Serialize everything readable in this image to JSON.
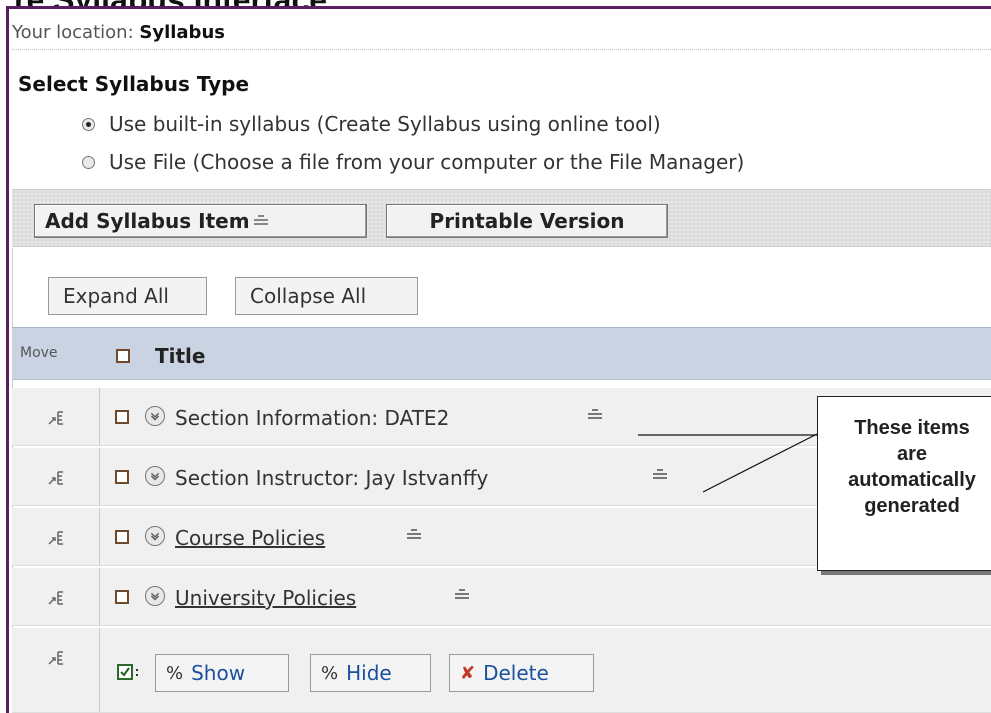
{
  "header": {
    "cut_title": "re Syllabus Interface",
    "location_prefix": "Your location:",
    "location": "Syllabus"
  },
  "syllabus_type": {
    "title": "Select Syllabus Type",
    "options": [
      {
        "label": "Use built-in syllabus  (Create Syllabus using online tool)",
        "selected": true
      },
      {
        "label": "Use File  (Choose a file from your computer or the File Manager)",
        "selected": false
      }
    ]
  },
  "toolbar": {
    "add_item": "Add Syllabus Item",
    "printable": "Printable Version"
  },
  "actions": {
    "expand_all": "Expand All",
    "collapse_all": "Collapse All"
  },
  "table": {
    "move_header": "Move",
    "title_header": "Title",
    "rows": [
      {
        "title": "Section Information: DATE2",
        "link": false
      },
      {
        "title": "Section Instructor: Jay Istvanffy",
        "link": false
      },
      {
        "title": "Course Policies",
        "link": true
      },
      {
        "title": "University Policies",
        "link": true
      }
    ]
  },
  "bulk": {
    "show": "Show",
    "hide": "Hide",
    "delete": "Delete"
  },
  "callout": {
    "line1": "These items",
    "line2": "are",
    "line3": "automatically",
    "line4": "generated"
  }
}
